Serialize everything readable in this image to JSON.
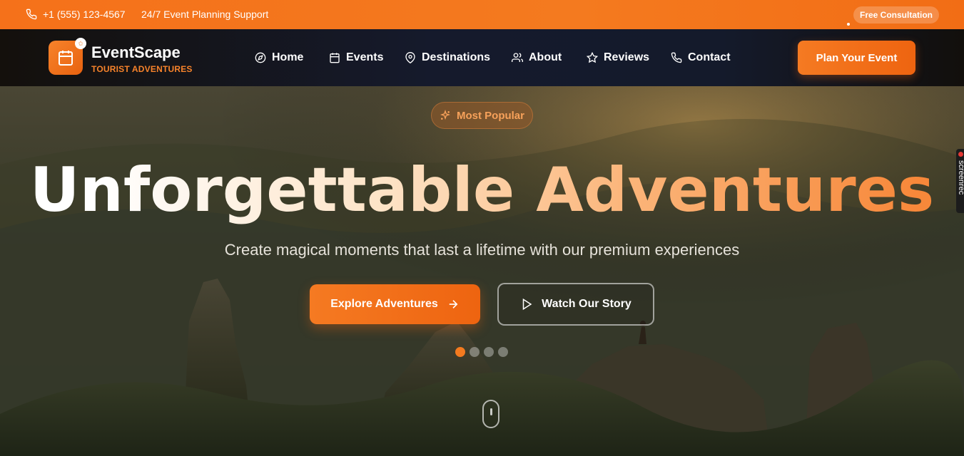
{
  "topbar": {
    "phone": "+1 (555) 123-4567",
    "support": "24/7 Event Planning Support",
    "consultation_label": "Free Consultation"
  },
  "brand": {
    "name": "EventScape",
    "tagline": "TOURIST ADVENTURES"
  },
  "nav": {
    "items": [
      {
        "label": "Home",
        "icon": "compass-icon"
      },
      {
        "label": "Events",
        "icon": "calendar-icon"
      },
      {
        "label": "Destinations",
        "icon": "map-pin-icon"
      },
      {
        "label": "About",
        "icon": "users-icon"
      },
      {
        "label": "Reviews",
        "icon": "star-icon"
      },
      {
        "label": "Contact",
        "icon": "phone-icon"
      }
    ],
    "cta_label": "Plan Your Event"
  },
  "hero": {
    "badge": "Most Popular",
    "headline": "Unforgettable Adventures",
    "subheadline": "Create magical moments that last a lifetime with our premium experiences",
    "primary_button": "Explore Adventures",
    "secondary_button": "Watch Our Story",
    "slides_total": 4,
    "active_slide": 1
  },
  "side_tab": {
    "label": "screenrec"
  },
  "colors": {
    "accent": "#f47a1f",
    "accent_dark": "#ee6410",
    "nav_bg": "#151a2c"
  }
}
